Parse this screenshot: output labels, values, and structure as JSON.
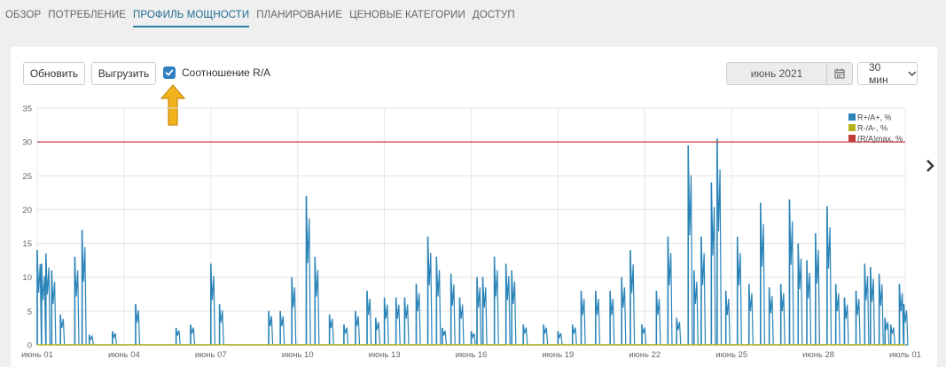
{
  "nav": {
    "tabs": [
      {
        "label": "ОБЗОР",
        "active": false
      },
      {
        "label": "ПОТРЕБЛЕНИЕ",
        "active": false
      },
      {
        "label": "ПРОФИЛЬ МОЩНОСТИ",
        "active": true
      },
      {
        "label": "ПЛАНИРОВАНИЕ",
        "active": false
      },
      {
        "label": "ЦЕНОВЫЕ КАТЕГОРИИ",
        "active": false
      },
      {
        "label": "ДОСТУП",
        "active": false
      }
    ]
  },
  "toolbar": {
    "refresh_label": "Обновить",
    "export_label": "Выгрузить",
    "ratio_checkbox_label": "Соотношение R/A",
    "ratio_checked": true,
    "month_value": "июнь 2021",
    "interval_value": "30 мин"
  },
  "colors": {
    "accent": "#2f7fc1",
    "series_r_plus": "#2b84b8",
    "series_r_minus": "#b7b21a",
    "series_max": "#c43a3a",
    "hint_arrow": "#f2b21c"
  },
  "icons": {
    "calendar": "calendar-icon",
    "chevron_down": "chevron-down-icon",
    "next": "chevron-right-icon",
    "check": "check-icon",
    "hint": "arrow-up-icon"
  },
  "chart_data": {
    "type": "line",
    "y_ticks": [
      "0",
      "5",
      "10",
      "15",
      "20",
      "25",
      "30",
      "35"
    ],
    "ylim": [
      0,
      35
    ],
    "x_ticks": [
      "июнь 01",
      "июнь 04",
      "июнь 07",
      "июнь 10",
      "июнь 13",
      "июнь 16",
      "июнь 19",
      "июнь 22",
      "июнь 25",
      "июнь 28",
      "июль 01"
    ],
    "xlim_days": [
      0,
      30
    ],
    "grid": true,
    "legend_position": "top-right",
    "series": [
      {
        "name": "R+/A+, %",
        "peaks": [
          [
            0.0,
            14
          ],
          [
            0.15,
            12
          ],
          [
            0.3,
            13.5
          ],
          [
            0.5,
            11
          ],
          [
            0.8,
            4.5
          ],
          [
            1.3,
            13
          ],
          [
            1.55,
            17
          ],
          [
            1.8,
            1.5
          ],
          [
            2.6,
            2
          ],
          [
            3.4,
            6
          ],
          [
            4.8,
            2.5
          ],
          [
            5.3,
            3
          ],
          [
            6.0,
            12
          ],
          [
            6.3,
            6
          ],
          [
            8.0,
            5
          ],
          [
            8.4,
            5
          ],
          [
            8.8,
            10
          ],
          [
            9.3,
            22
          ],
          [
            9.6,
            13
          ],
          [
            10.1,
            4.5
          ],
          [
            10.6,
            3
          ],
          [
            11.0,
            5
          ],
          [
            11.4,
            8
          ],
          [
            11.7,
            4
          ],
          [
            12.0,
            7
          ],
          [
            12.4,
            7
          ],
          [
            12.7,
            7
          ],
          [
            13.1,
            9
          ],
          [
            13.5,
            16
          ],
          [
            13.8,
            13
          ],
          [
            14.0,
            2.5
          ],
          [
            14.3,
            10.5
          ],
          [
            14.6,
            7
          ],
          [
            15.0,
            2
          ],
          [
            15.2,
            10
          ],
          [
            15.4,
            10
          ],
          [
            15.8,
            13
          ],
          [
            16.2,
            12
          ],
          [
            16.4,
            11
          ],
          [
            16.8,
            3
          ],
          [
            17.5,
            3
          ],
          [
            18.0,
            2
          ],
          [
            18.5,
            3
          ],
          [
            18.8,
            8
          ],
          [
            19.3,
            8
          ],
          [
            19.8,
            8
          ],
          [
            20.2,
            10
          ],
          [
            20.5,
            14
          ],
          [
            20.9,
            3
          ],
          [
            21.4,
            8
          ],
          [
            21.8,
            16
          ],
          [
            22.1,
            4
          ],
          [
            22.5,
            29.5
          ],
          [
            22.7,
            11
          ],
          [
            22.95,
            16
          ],
          [
            23.3,
            24
          ],
          [
            23.5,
            30.5
          ],
          [
            23.8,
            8
          ],
          [
            24.2,
            16
          ],
          [
            24.6,
            9
          ],
          [
            25.0,
            21
          ],
          [
            25.3,
            8.5
          ],
          [
            25.7,
            9
          ],
          [
            26.0,
            21.5
          ],
          [
            26.3,
            15
          ],
          [
            26.6,
            12.5
          ],
          [
            26.9,
            16.5
          ],
          [
            27.3,
            20.5
          ],
          [
            27.6,
            9
          ],
          [
            27.9,
            7
          ],
          [
            28.3,
            8
          ],
          [
            28.6,
            12
          ],
          [
            28.8,
            11.5
          ],
          [
            29.1,
            10.5
          ],
          [
            29.3,
            4
          ],
          [
            29.5,
            3
          ],
          [
            29.8,
            9
          ],
          [
            29.95,
            6
          ]
        ]
      },
      {
        "name": "R-/A-, %",
        "values": "0 throughout"
      },
      {
        "name": "(R/A)max, %",
        "value": 30
      }
    ]
  }
}
